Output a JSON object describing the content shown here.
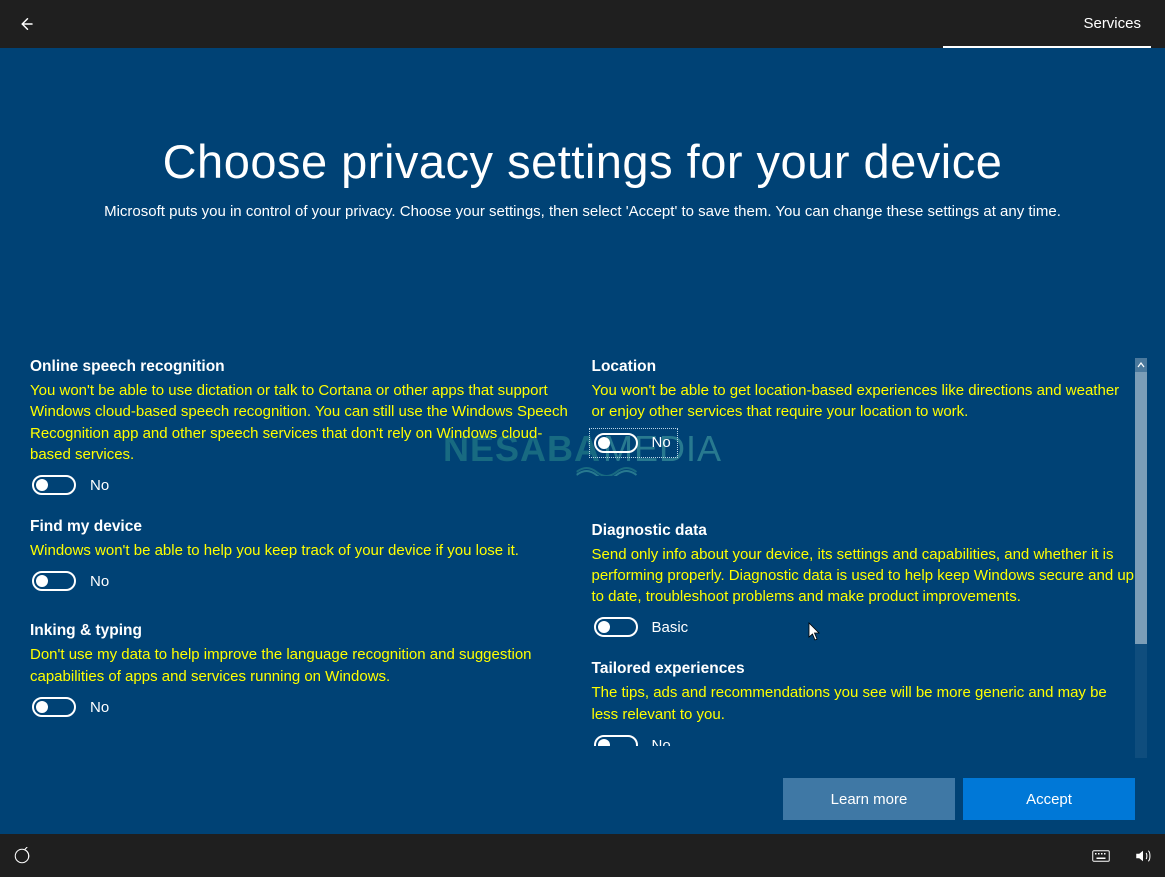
{
  "topbar": {
    "tab": "Services"
  },
  "page": {
    "title": "Choose privacy settings for your device",
    "subtitle": "Microsoft puts you in control of your privacy. Choose your settings, then select 'Accept' to save them. You can change these settings at any time."
  },
  "watermark": {
    "a": "NESABA",
    "b": "MEDIA"
  },
  "settings": {
    "speech": {
      "title": "Online speech recognition",
      "desc": "You won't be able to use dictation or talk to Cortana or other apps that support Windows cloud-based speech recognition. You can still use the Windows Speech Recognition app and other speech services that don't rely on Windows cloud-based services.",
      "state": "No"
    },
    "findmydevice": {
      "title": "Find my device",
      "desc": "Windows won't be able to help you keep track of your device if you lose it.",
      "state": "No"
    },
    "inking": {
      "title": "Inking & typing",
      "desc": "Don't use my data to help improve the language recognition and suggestion capabilities of apps and services running on Windows.",
      "state": "No"
    },
    "location": {
      "title": "Location",
      "desc": "You won't be able to get location-based experiences like directions and weather or enjoy other services that require your location to work.",
      "state": "No"
    },
    "diagnostic": {
      "title": "Diagnostic data",
      "desc": "Send only info about your device, its settings and capabilities, and whether it is performing properly. Diagnostic data is used to help keep Windows secure and up to date, troubleshoot problems and make product improvements.",
      "state": "Basic"
    },
    "tailored": {
      "title": "Tailored experiences",
      "desc": "The tips, ads and recommendations you see will be more generic and may be less relevant to you.",
      "state": "No"
    }
  },
  "footer": {
    "learn": "Learn more",
    "accept": "Accept"
  }
}
